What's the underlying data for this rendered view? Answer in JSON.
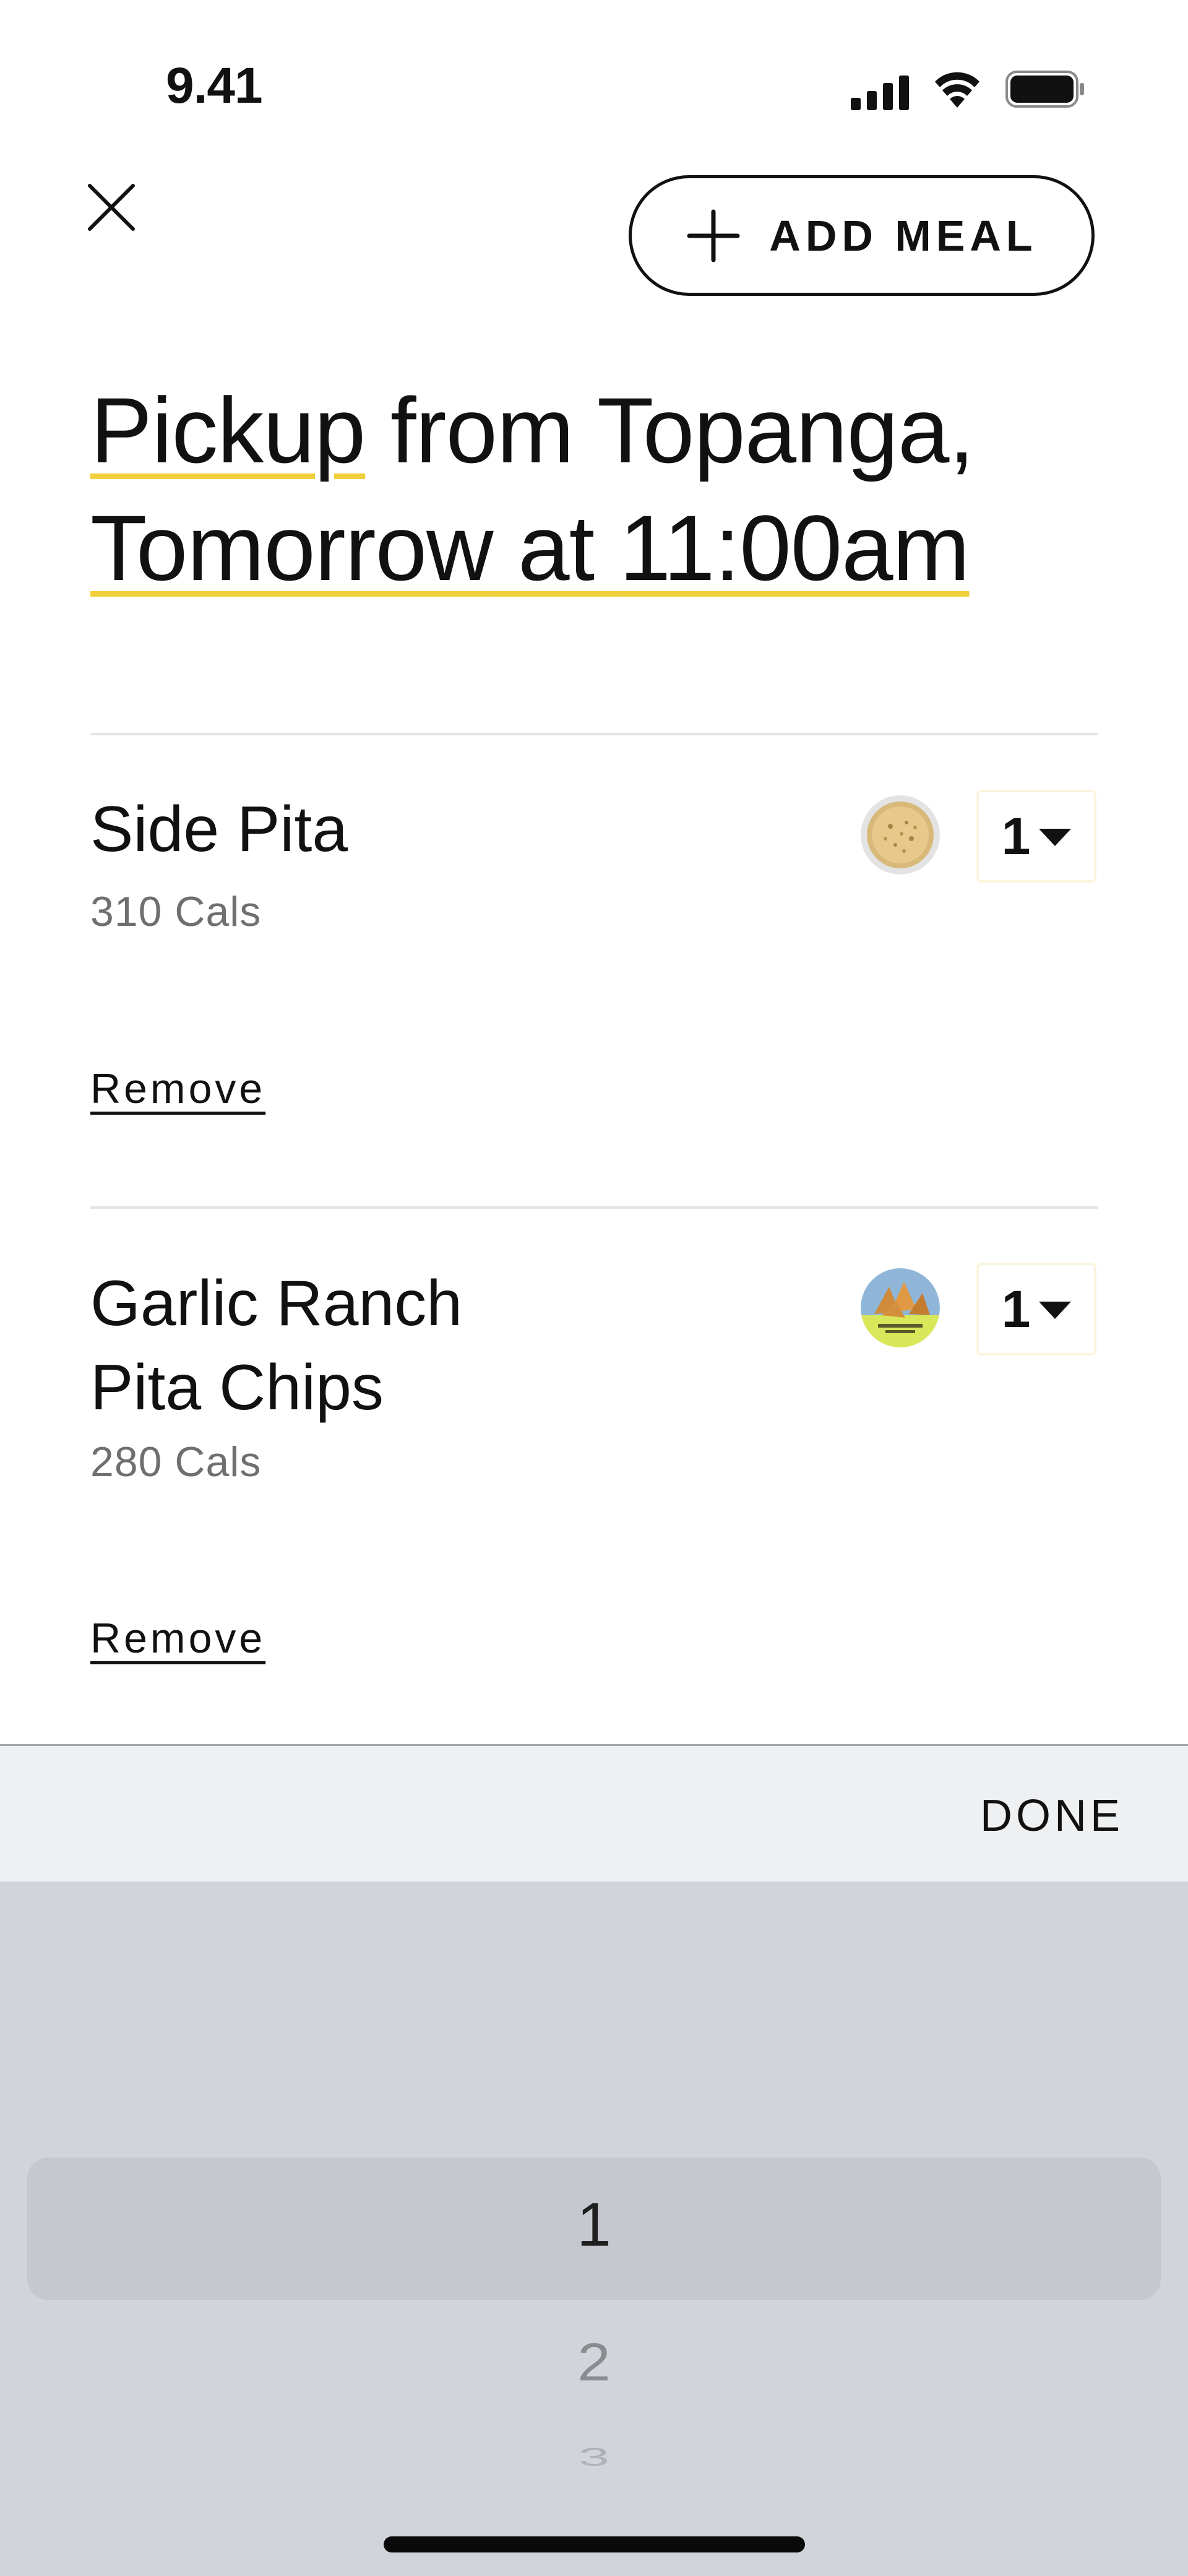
{
  "status_bar": {
    "time": "9.41",
    "icons": [
      "cellular-signal-icon",
      "wifi-icon",
      "battery-icon"
    ]
  },
  "header": {
    "close_icon": "close-icon",
    "add_meal_label": "ADD MEAL",
    "add_meal_icon": "plus-icon"
  },
  "title": {
    "mode": "Pickup",
    "from_text": " from ",
    "location": "Topanga,",
    "day": "Tomorrow",
    "at_text": " at ",
    "time": "11:00am"
  },
  "items": [
    {
      "name_lines": [
        "Side Pita"
      ],
      "cals": "310 Cals",
      "quantity": "1",
      "remove_label": "Remove",
      "thumb_icon": "pita-bread-icon"
    },
    {
      "name_lines": [
        "Garlic Ranch",
        "Pita Chips"
      ],
      "cals": "280 Cals",
      "quantity": "1",
      "remove_label": "Remove",
      "thumb_icon": "pita-chips-icon"
    }
  ],
  "picker": {
    "done_label": "DONE",
    "options": [
      "1",
      "2",
      "3"
    ],
    "selected": "1"
  },
  "colors": {
    "underline_accent": "#f1cf3b",
    "picker_background": "#d1d4db",
    "toolbar_background": "#eff0f2",
    "muted_text": "#6f6f6f"
  }
}
